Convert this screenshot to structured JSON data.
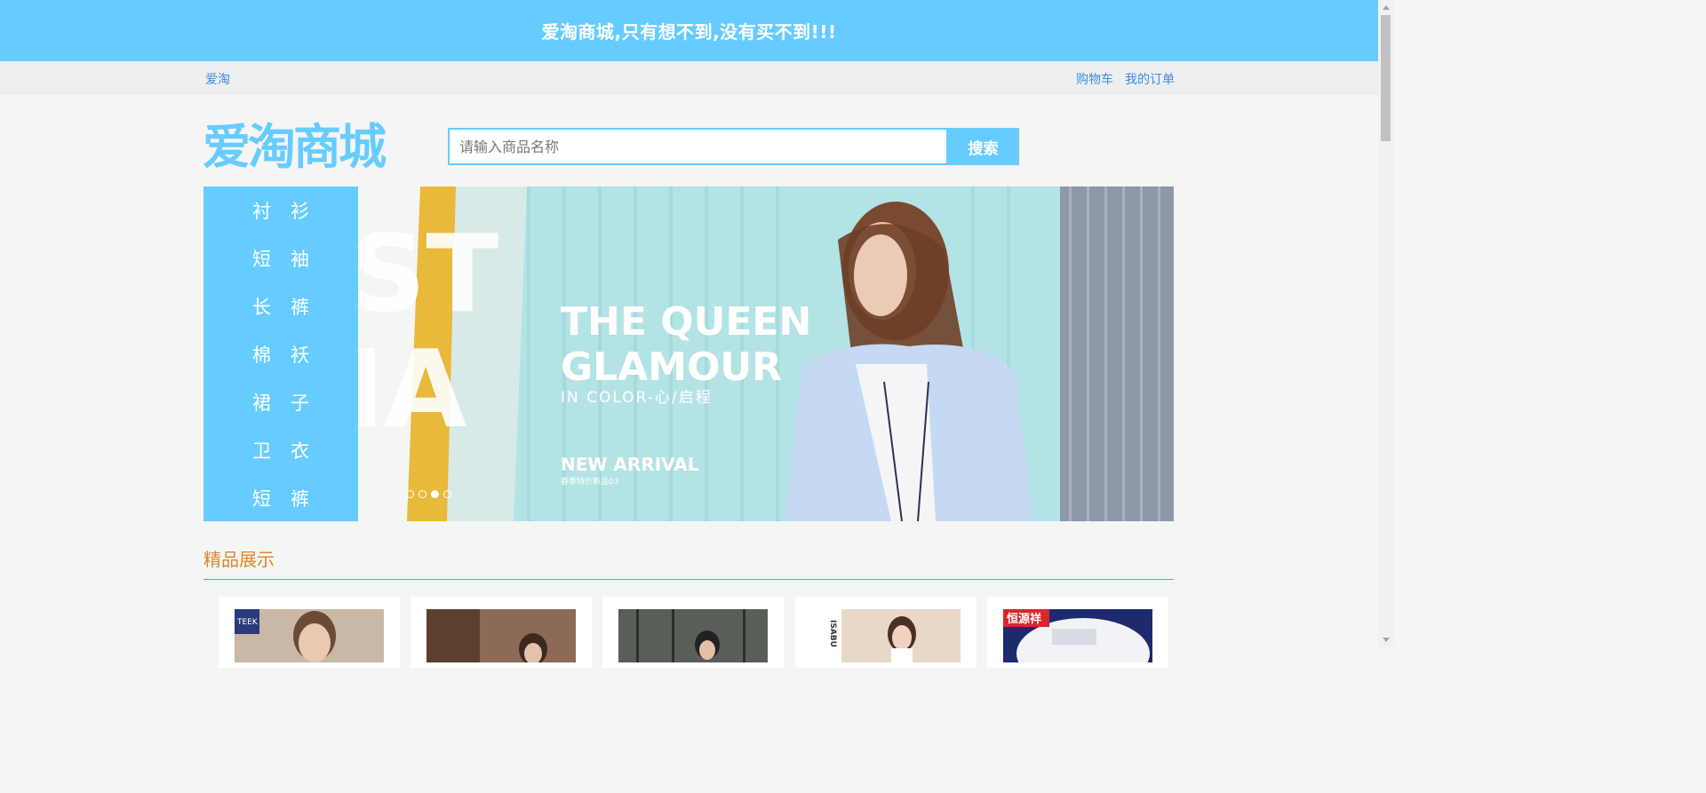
{
  "top_banner": {
    "text": "爱淘商城,只有想不到,没有买不到!!!"
  },
  "nav": {
    "home_link": "爱淘",
    "cart_link": "购物车",
    "orders_link": "我的订单"
  },
  "logo": {
    "text": "爱淘商城"
  },
  "search": {
    "placeholder": "请输入商品名称",
    "value": "",
    "button_label": "搜索"
  },
  "categories": [
    "衬衫",
    "短袖",
    "长裤",
    "棉袄",
    "裙子",
    "卫衣",
    "短裤"
  ],
  "carousel": {
    "headline_line1": "THE QUEEN",
    "headline_line2": "GLAMOUR",
    "subline": "IN COLOR-心/启程",
    "tag": "NEW ARRIVAL",
    "tag_small": "春季特价新品03",
    "bg_letters_top": "ST",
    "bg_letters_bottom": "IA",
    "slide_count": 4,
    "active_slide": 3
  },
  "section": {
    "title": "精品展示"
  },
  "products": [
    {
      "thumb_label": "TEEK",
      "thumb_color": "#c9b8a6"
    },
    {
      "thumb_label": "",
      "thumb_color": "#8c6a55"
    },
    {
      "thumb_label": "",
      "thumb_color": "#5a5e58"
    },
    {
      "thumb_label": "ISABU",
      "thumb_color": "#e8d8c8"
    },
    {
      "thumb_label": "恒源祥",
      "thumb_color": "#1e2a6e"
    }
  ],
  "colors": {
    "accent": "#66ccff",
    "link": "#3a8de0",
    "section_title": "#d98a2a",
    "background": "#f5f5f5",
    "nav_bar": "#eeeeee"
  }
}
